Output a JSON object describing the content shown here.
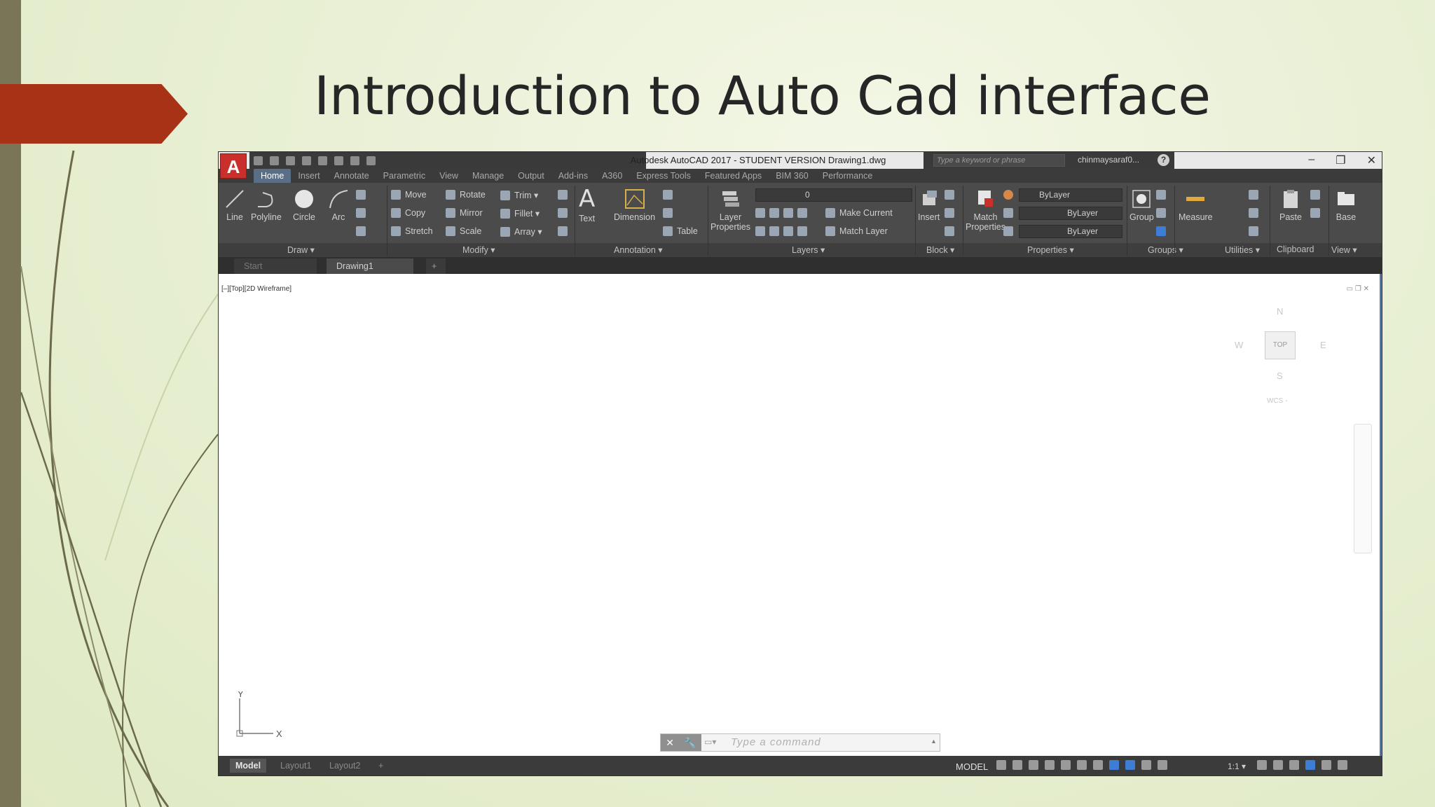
{
  "slide": {
    "title": "Introduction to Auto Cad interface",
    "accent_color": "#a83216",
    "bar_color": "#7a7556"
  },
  "window": {
    "app_button": "A",
    "title": "Autodesk AutoCAD 2017 - STUDENT VERSION    Drawing1.dwg",
    "search_placeholder": "Type a keyword or phrase",
    "user": "chinmaysaraf0...",
    "help": "?",
    "minimize": "–",
    "restore": "❐",
    "close": "✕"
  },
  "ribbon_tabs": [
    "Home",
    "Insert",
    "Annotate",
    "Parametric",
    "View",
    "Manage",
    "Output",
    "Add-ins",
    "A360",
    "Express Tools",
    "Featured Apps",
    "BIM 360",
    "Performance"
  ],
  "ribbon": {
    "draw": {
      "line": "Line",
      "polyline": "Polyline",
      "circle": "Circle",
      "arc": "Arc",
      "label": "Draw ▾"
    },
    "modify": {
      "move": "Move",
      "rotate": "Rotate",
      "trim": "Trim ▾",
      "copy": "Copy",
      "mirror": "Mirror",
      "fillet": "Fillet ▾",
      "stretch": "Stretch",
      "scale": "Scale",
      "array": "Array ▾",
      "label": "Modify ▾"
    },
    "annotation": {
      "text": "Text",
      "dimension": "Dimension",
      "table": "Table",
      "label": "Annotation ▾"
    },
    "layers": {
      "layer_properties_1": "Layer",
      "layer_properties_2": "Properties",
      "layer_value": "0",
      "make_current": "Make Current",
      "match_layer": "Match Layer",
      "label": "Layers ▾"
    },
    "block": {
      "insert": "Insert",
      "label": "Block ▾"
    },
    "properties": {
      "match_1": "Match",
      "match_2": "Properties",
      "color": "ByLayer",
      "linetype": "ByLayer",
      "lineweight": "ByLayer",
      "label": "Properties ▾"
    },
    "groups": {
      "group": "Group",
      "label": "Groups ▾"
    },
    "utilities": {
      "measure": "Measure",
      "label": "Utilities ▾"
    },
    "clipboard": {
      "paste": "Paste",
      "label": "Clipboard"
    },
    "view": {
      "base": "Base",
      "label": "View ▾"
    }
  },
  "doc_tabs": {
    "start": "Start",
    "drawing": "Drawing1",
    "add": "+"
  },
  "viewport": {
    "label": "[–][Top][2D Wireframe]",
    "compass_n": "N",
    "compass_w": "W",
    "compass_e": "E",
    "compass_s": "S",
    "cube_face": "TOP",
    "wcs": "WCS ◦"
  },
  "ucs": {
    "x": "X",
    "y": "Y"
  },
  "command": {
    "placeholder": "Type  a  command"
  },
  "layout_tabs": {
    "model": "Model",
    "layout1": "Layout1",
    "layout2": "Layout2",
    "add": "+"
  },
  "status": {
    "model": "MODEL",
    "scale": "1:1 ▾"
  }
}
